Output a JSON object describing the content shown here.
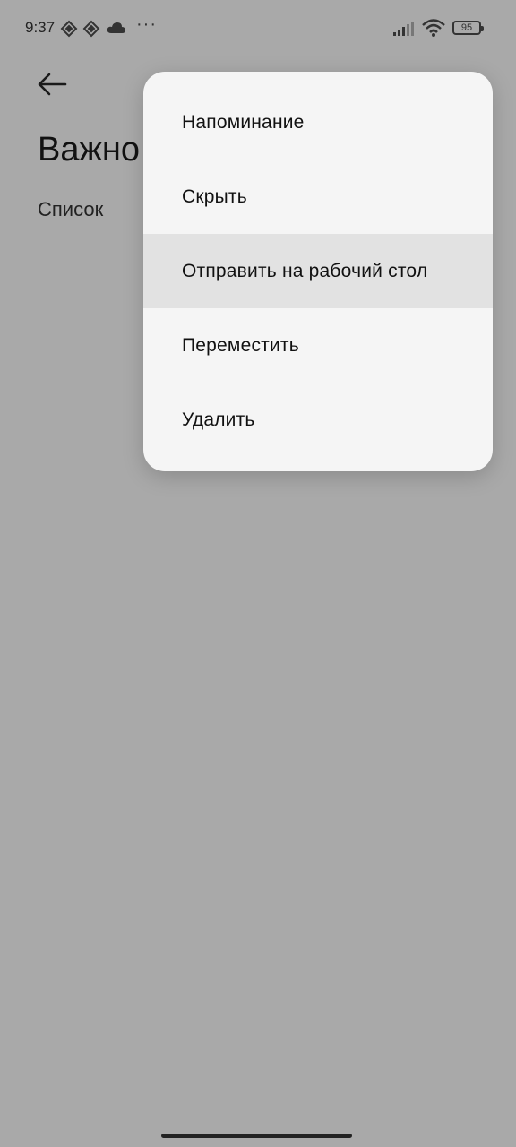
{
  "status_bar": {
    "time": "9:37",
    "icons": [
      "binance-icon",
      "binance-icon",
      "cloud-icon",
      "more-dots-icon"
    ],
    "more": "···",
    "battery": "95"
  },
  "page": {
    "back_icon": "arrow-left-icon",
    "title": "Важно",
    "list_label": "Список"
  },
  "menu": {
    "items": [
      {
        "label": "Напоминание"
      },
      {
        "label": "Скрыть"
      },
      {
        "label": "Отправить на рабочий стол"
      },
      {
        "label": "Переместить"
      },
      {
        "label": "Удалить"
      }
    ],
    "highlighted_index": 2
  },
  "colors": {
    "scrim": "#a9a9a9",
    "menu_background": "#f5f5f5",
    "menu_highlight": "#e2e2e2"
  }
}
